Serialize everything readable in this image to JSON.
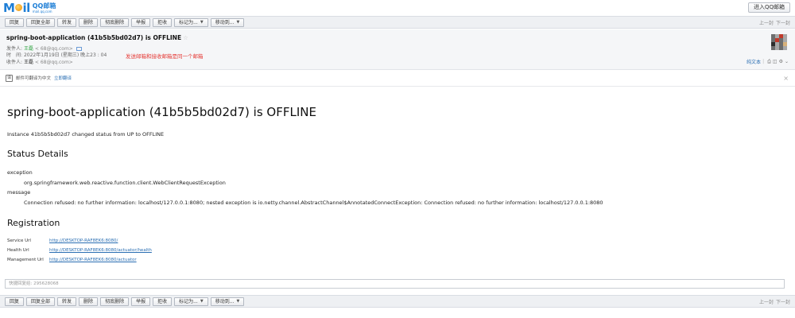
{
  "logo": {
    "mail": "Mail",
    "brand": "QQ邮箱",
    "domain": "mail.qq.com"
  },
  "topbar": {
    "enter_label": "进入QQ邮箱"
  },
  "toolbar": {
    "buttons": [
      "回复",
      "回复全部",
      "转发",
      "删除",
      "彻底删除",
      "举报",
      "拒收",
      "标记为...",
      "移动到..."
    ],
    "pager_prev": "上一封",
    "pager_next": "下一封"
  },
  "header": {
    "subject": "spring-boot-application (41b5b5bd02d7) is OFFLINE",
    "star_icon": "star-outline-icon",
    "from_label": "发件人:",
    "from_name": "王磊",
    "from_addr": "<            68@qq.com>",
    "time_label": "时　间:",
    "time_value": "2022年1月19日 (星期三) 晚上23 : 04",
    "to_label": "收件人:",
    "to_name": "王磊",
    "to_addr": "<            68@qq.com>",
    "note": "发送邮箱和接收邮箱是同一个邮箱",
    "actions": {
      "plain_text": "纯文本",
      "icons": [
        "print-icon",
        "window-icon",
        "settings-icon",
        "chevron-down-icon"
      ]
    }
  },
  "translate": {
    "text": "邮件可翻译为中文",
    "link": "立即翻译"
  },
  "message": {
    "title": "spring-boot-application (41b5b5bd02d7) is OFFLINE",
    "intro": "Instance 41b5b5bd02d7 changed status from UP to OFFLINE",
    "status_heading": "Status Details",
    "exception_label": "exception",
    "exception_value": "org.springframework.web.reactive.function.client.WebClientRequestException",
    "message_label": "message",
    "message_value": "Connection refused: no further information: localhost/127.0.0.1:8080; nested exception is io.netty.channel.AbstractChannel$AnnotatedConnectException: Connection refused: no further information: localhost/127.0.0.1:8080",
    "registration_heading": "Registration",
    "registration": [
      {
        "label": "Service Url",
        "value": "http://DESKTOP-RAF8EK6:8080/"
      },
      {
        "label": "Health Url",
        "value": "http://DESKTOP-RAF8EK6:8080/actuator/health"
      },
      {
        "label": "Management Url",
        "value": "http://DESKTOP-RAF8EK6:8080/actuator"
      }
    ]
  },
  "quick_reply": {
    "placeholder": "快捷回复给: 295628068"
  }
}
